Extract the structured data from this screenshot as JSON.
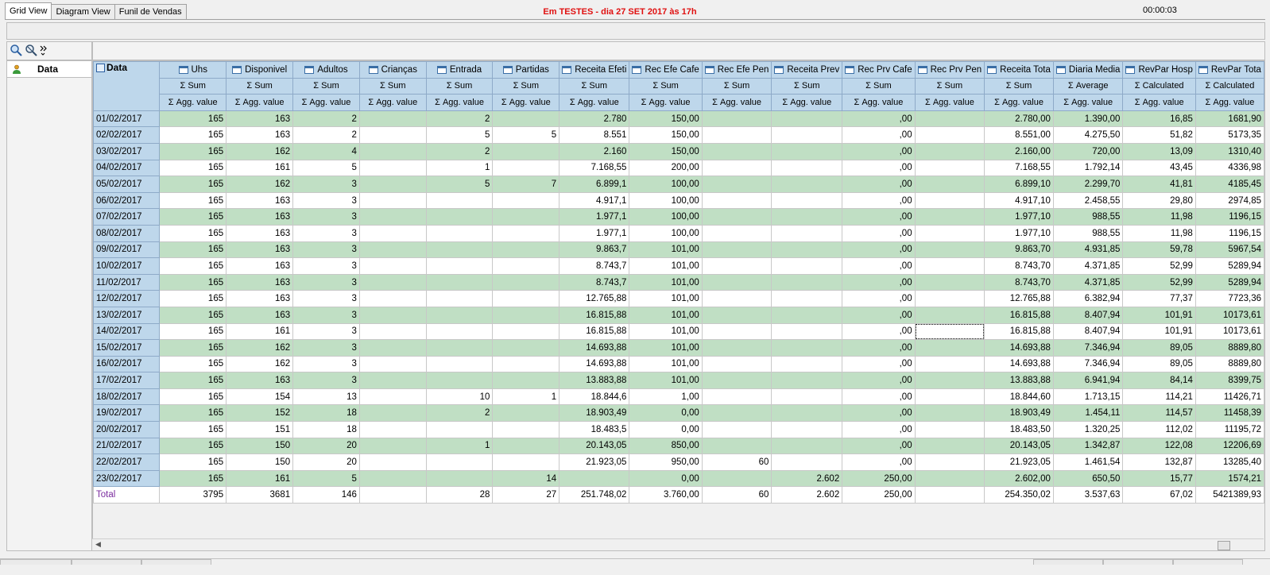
{
  "tabs": [
    {
      "label": "Grid View",
      "active": true
    },
    {
      "label": "Diagram View",
      "active": false
    },
    {
      "label": "Funil de Vendas",
      "active": false
    }
  ],
  "banner": "Em TESTES - dia 27 SET 2017 às 17h",
  "clock": "00:00:03",
  "row_field": "Data",
  "corner_label": "Data",
  "columns": [
    {
      "name": "Uhs",
      "agg": "Σ Sum",
      "value_label": "Σ Agg. value"
    },
    {
      "name": "Disponivel",
      "agg": "Σ Sum",
      "value_label": "Σ Agg. value"
    },
    {
      "name": "Adultos",
      "agg": "Σ Sum",
      "value_label": "Σ Agg. value"
    },
    {
      "name": "Crianças",
      "agg": "Σ Sum",
      "value_label": "Σ Agg. value"
    },
    {
      "name": "Entrada",
      "agg": "Σ Sum",
      "value_label": "Σ Agg. value"
    },
    {
      "name": "Partidas",
      "agg": "Σ Sum",
      "value_label": "Σ Agg. value"
    },
    {
      "name": "Receita Efeti",
      "agg": "Σ Sum",
      "value_label": "Σ Agg. value"
    },
    {
      "name": "Rec Efe Cafe",
      "agg": "Σ Sum",
      "value_label": "Σ Agg. value"
    },
    {
      "name": "Rec Efe Pen",
      "agg": "Σ Sum",
      "value_label": "Σ Agg. value"
    },
    {
      "name": "Receita Prev",
      "agg": "Σ Sum",
      "value_label": "Σ Agg. value"
    },
    {
      "name": "Rec Prv Cafe",
      "agg": "Σ Sum",
      "value_label": "Σ Agg. value"
    },
    {
      "name": "Rec Prv Pen",
      "agg": "Σ Sum",
      "value_label": "Σ Agg. value"
    },
    {
      "name": "Receita Tota",
      "agg": "Σ Sum",
      "value_label": "Σ Agg. value"
    },
    {
      "name": "Diaria Media",
      "agg": "Σ Average",
      "value_label": "Σ Agg. value"
    },
    {
      "name": "RevPar Hosp",
      "agg": "Σ Calculated",
      "value_label": "Σ Agg. value"
    },
    {
      "name": "RevPar Tota",
      "agg": "Σ Calculated",
      "value_label": "Σ Agg. value"
    }
  ],
  "rows": [
    {
      "label": "01/02/2017",
      "cells": [
        "165",
        "163",
        "2",
        "",
        "2",
        "",
        "2.780",
        "150,00",
        "",
        "",
        ",00",
        "",
        "2.780,00",
        "1.390,00",
        "16,85",
        "1681,90"
      ]
    },
    {
      "label": "02/02/2017",
      "cells": [
        "165",
        "163",
        "2",
        "",
        "5",
        "5",
        "8.551",
        "150,00",
        "",
        "",
        ",00",
        "",
        "8.551,00",
        "4.275,50",
        "51,82",
        "5173,35"
      ]
    },
    {
      "label": "03/02/2017",
      "cells": [
        "165",
        "162",
        "4",
        "",
        "2",
        "",
        "2.160",
        "150,00",
        "",
        "",
        ",00",
        "",
        "2.160,00",
        "720,00",
        "13,09",
        "1310,40"
      ]
    },
    {
      "label": "04/02/2017",
      "cells": [
        "165",
        "161",
        "5",
        "",
        "1",
        "",
        "7.168,55",
        "200,00",
        "",
        "",
        ",00",
        "",
        "7.168,55",
        "1.792,14",
        "43,45",
        "4336,98"
      ]
    },
    {
      "label": "05/02/2017",
      "cells": [
        "165",
        "162",
        "3",
        "",
        "5",
        "7",
        "6.899,1",
        "100,00",
        "",
        "",
        ",00",
        "",
        "6.899,10",
        "2.299,70",
        "41,81",
        "4185,45"
      ]
    },
    {
      "label": "06/02/2017",
      "cells": [
        "165",
        "163",
        "3",
        "",
        "",
        "",
        "4.917,1",
        "100,00",
        "",
        "",
        ",00",
        "",
        "4.917,10",
        "2.458,55",
        "29,80",
        "2974,85"
      ]
    },
    {
      "label": "07/02/2017",
      "cells": [
        "165",
        "163",
        "3",
        "",
        "",
        "",
        "1.977,1",
        "100,00",
        "",
        "",
        ",00",
        "",
        "1.977,10",
        "988,55",
        "11,98",
        "1196,15"
      ]
    },
    {
      "label": "08/02/2017",
      "cells": [
        "165",
        "163",
        "3",
        "",
        "",
        "",
        "1.977,1",
        "100,00",
        "",
        "",
        ",00",
        "",
        "1.977,10",
        "988,55",
        "11,98",
        "1196,15"
      ]
    },
    {
      "label": "09/02/2017",
      "cells": [
        "165",
        "163",
        "3",
        "",
        "",
        "",
        "9.863,7",
        "101,00",
        "",
        "",
        ",00",
        "",
        "9.863,70",
        "4.931,85",
        "59,78",
        "5967,54"
      ]
    },
    {
      "label": "10/02/2017",
      "cells": [
        "165",
        "163",
        "3",
        "",
        "",
        "",
        "8.743,7",
        "101,00",
        "",
        "",
        ",00",
        "",
        "8.743,70",
        "4.371,85",
        "52,99",
        "5289,94"
      ]
    },
    {
      "label": "11/02/2017",
      "cells": [
        "165",
        "163",
        "3",
        "",
        "",
        "",
        "8.743,7",
        "101,00",
        "",
        "",
        ",00",
        "",
        "8.743,70",
        "4.371,85",
        "52,99",
        "5289,94"
      ]
    },
    {
      "label": "12/02/2017",
      "cells": [
        "165",
        "163",
        "3",
        "",
        "",
        "",
        "12.765,88",
        "101,00",
        "",
        "",
        ",00",
        "",
        "12.765,88",
        "6.382,94",
        "77,37",
        "7723,36"
      ]
    },
    {
      "label": "13/02/2017",
      "cells": [
        "165",
        "163",
        "3",
        "",
        "",
        "",
        "16.815,88",
        "101,00",
        "",
        "",
        ",00",
        "",
        "16.815,88",
        "8.407,94",
        "101,91",
        "10173,61"
      ]
    },
    {
      "label": "14/02/2017",
      "cells": [
        "165",
        "161",
        "3",
        "",
        "",
        "",
        "16.815,88",
        "101,00",
        "",
        "",
        ",00",
        "",
        "16.815,88",
        "8.407,94",
        "101,91",
        "10173,61"
      ]
    },
    {
      "label": "15/02/2017",
      "cells": [
        "165",
        "162",
        "3",
        "",
        "",
        "",
        "14.693,88",
        "101,00",
        "",
        "",
        ",00",
        "",
        "14.693,88",
        "7.346,94",
        "89,05",
        "8889,80"
      ]
    },
    {
      "label": "16/02/2017",
      "cells": [
        "165",
        "162",
        "3",
        "",
        "",
        "",
        "14.693,88",
        "101,00",
        "",
        "",
        ",00",
        "",
        "14.693,88",
        "7.346,94",
        "89,05",
        "8889,80"
      ]
    },
    {
      "label": "17/02/2017",
      "cells": [
        "165",
        "163",
        "3",
        "",
        "",
        "",
        "13.883,88",
        "101,00",
        "",
        "",
        ",00",
        "",
        "13.883,88",
        "6.941,94",
        "84,14",
        "8399,75"
      ]
    },
    {
      "label": "18/02/2017",
      "cells": [
        "165",
        "154",
        "13",
        "",
        "10",
        "1",
        "18.844,6",
        "1,00",
        "",
        "",
        ",00",
        "",
        "18.844,60",
        "1.713,15",
        "114,21",
        "11426,71"
      ]
    },
    {
      "label": "19/02/2017",
      "cells": [
        "165",
        "152",
        "18",
        "",
        "2",
        "",
        "18.903,49",
        "0,00",
        "",
        "",
        ",00",
        "",
        "18.903,49",
        "1.454,11",
        "114,57",
        "11458,39"
      ]
    },
    {
      "label": "20/02/2017",
      "cells": [
        "165",
        "151",
        "18",
        "",
        "",
        "",
        "18.483,5",
        "0,00",
        "",
        "",
        ",00",
        "",
        "18.483,50",
        "1.320,25",
        "112,02",
        "11195,72"
      ]
    },
    {
      "label": "21/02/2017",
      "cells": [
        "165",
        "150",
        "20",
        "",
        "1",
        "",
        "20.143,05",
        "850,00",
        "",
        "",
        ",00",
        "",
        "20.143,05",
        "1.342,87",
        "122,08",
        "12206,69"
      ]
    },
    {
      "label": "22/02/2017",
      "cells": [
        "165",
        "150",
        "20",
        "",
        "",
        "",
        "21.923,05",
        "950,00",
        "60",
        "",
        ",00",
        "",
        "21.923,05",
        "1.461,54",
        "132,87",
        "13285,40"
      ]
    },
    {
      "label": "23/02/2017",
      "cells": [
        "165",
        "161",
        "5",
        "",
        "",
        "14",
        "",
        "0,00",
        "",
        "2.602",
        "250,00",
        "",
        "2.602,00",
        "650,50",
        "15,77",
        "1574,21"
      ]
    }
  ],
  "total": {
    "label": "Total",
    "cells": [
      "3795",
      "3681",
      "146",
      "",
      "28",
      "27",
      "251.748,02",
      "3.760,00",
      "60",
      "2.602",
      "250,00",
      "",
      "254.350,02",
      "3.537,63",
      "67,02",
      "5421389,93"
    ]
  },
  "colors": {
    "header_bg": "#bed7eb",
    "row_green": "#c0dfc4",
    "banner_red": "#e01010",
    "total_purple": "#7a2b9e"
  }
}
